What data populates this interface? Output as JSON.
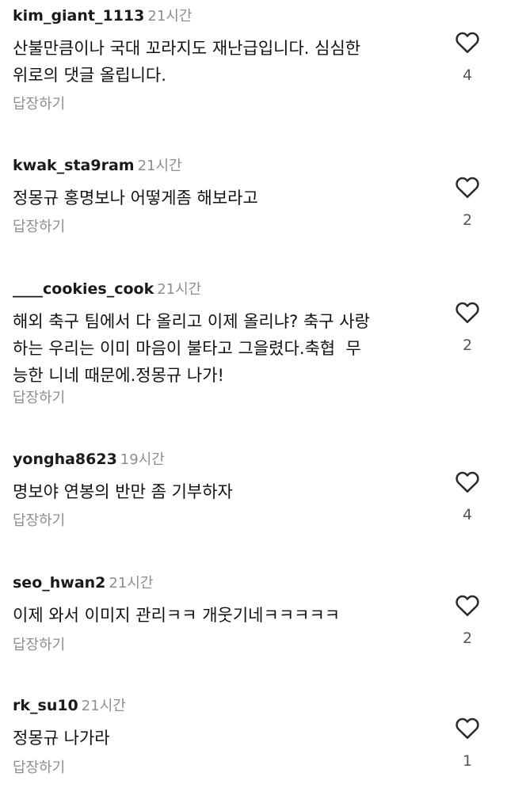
{
  "comments": [
    {
      "username": "kim_giant_1113",
      "time": "21시간",
      "text": "산불만큼이나 국대 꼬라지도 재난급입니다. 심심한\n위로의 댓글 올립니다.",
      "reply_label": "답장하기",
      "likes": "4",
      "icon": "heart-outline-icon"
    },
    {
      "username": "kwak_sta9ram",
      "time": "21시간",
      "text": "정몽규 홍명보나 어떻게좀 해보라고",
      "reply_label": "답장하기",
      "likes": "2",
      "icon": "heart-outline-icon"
    },
    {
      "username": "____cookies_cook",
      "time": "21시간",
      "text": "해외 축구 팀에서 다 올리고 이제 올리냐? 축구 사랑\n하는 우리는 이미 마음이 불타고 그을렸다.축협  무\n능한 니네 때문에.정몽규 나가!",
      "reply_label": "답장하기",
      "likes": "2",
      "icon": "heart-outline-icon"
    },
    {
      "username": "yongha8623",
      "time": "19시간",
      "text": "명보야 연봉의 반만 좀 기부하자",
      "reply_label": "답장하기",
      "likes": "4",
      "icon": "heart-outline-icon"
    },
    {
      "username": "seo_hwan2",
      "time": "21시간",
      "text": "이제 와서 이미지 관리ㅋㅋ 개웃기네ㅋㅋㅋㅋㅋ",
      "reply_label": "답장하기",
      "likes": "2",
      "icon": "heart-outline-icon"
    },
    {
      "username": "rk_su10",
      "time": "21시간",
      "text": "정몽규 나가라",
      "reply_label": "답장하기",
      "likes": "1",
      "icon": "heart-outline-icon"
    }
  ]
}
